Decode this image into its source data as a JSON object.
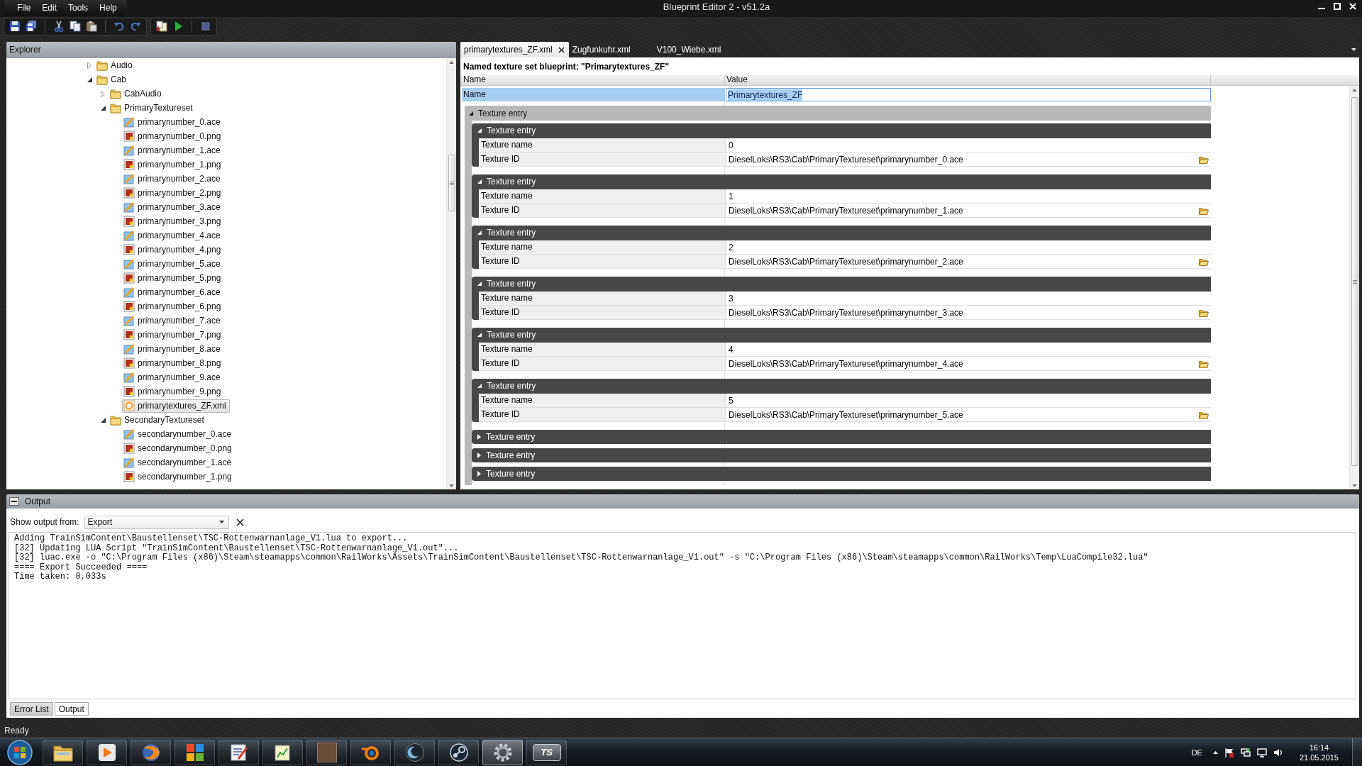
{
  "window": {
    "title": "Blueprint Editor 2 - v51.2a"
  },
  "menu": [
    "File",
    "Edit",
    "Tools",
    "Help"
  ],
  "explorer": {
    "title": "Explorer",
    "tree": [
      {
        "label": "Audio",
        "kind": "folder",
        "expanded": false,
        "selected": false
      },
      {
        "label": "Cab",
        "kind": "folder",
        "expanded": true,
        "selected": false,
        "children": [
          {
            "label": "CabAudio",
            "kind": "folder",
            "expanded": false,
            "selected": false
          },
          {
            "label": "PrimaryTextureset",
            "kind": "folder",
            "expanded": true,
            "selected": false,
            "children": [
              {
                "label": "primarynumber_0.ace",
                "kind": "texture",
                "selected": false
              },
              {
                "label": "primarynumber_0.png",
                "kind": "image",
                "selected": false
              },
              {
                "label": "primarynumber_1.ace",
                "kind": "texture",
                "selected": false
              },
              {
                "label": "primarynumber_1.png",
                "kind": "image",
                "selected": false
              },
              {
                "label": "primarynumber_2.ace",
                "kind": "texture",
                "selected": false
              },
              {
                "label": "primarynumber_2.png",
                "kind": "image",
                "selected": false
              },
              {
                "label": "primarynumber_3.ace",
                "kind": "texture",
                "selected": false
              },
              {
                "label": "primarynumber_3.png",
                "kind": "image",
                "selected": false
              },
              {
                "label": "primarynumber_4.ace",
                "kind": "texture",
                "selected": false
              },
              {
                "label": "primarynumber_4.png",
                "kind": "image",
                "selected": false
              },
              {
                "label": "primarynumber_5.ace",
                "kind": "texture",
                "selected": false
              },
              {
                "label": "primarynumber_5.png",
                "kind": "image",
                "selected": false
              },
              {
                "label": "primarynumber_6.ace",
                "kind": "texture",
                "selected": false
              },
              {
                "label": "primarynumber_6.png",
                "kind": "image",
                "selected": false
              },
              {
                "label": "primarynumber_7.ace",
                "kind": "texture",
                "selected": false
              },
              {
                "label": "primarynumber_7.png",
                "kind": "image",
                "selected": false
              },
              {
                "label": "primarynumber_8.ace",
                "kind": "texture",
                "selected": false
              },
              {
                "label": "primarynumber_8.png",
                "kind": "image",
                "selected": false
              },
              {
                "label": "primarynumber_9.ace",
                "kind": "texture",
                "selected": false
              },
              {
                "label": "primarynumber_9.png",
                "kind": "image",
                "selected": false
              },
              {
                "label": "primarytextures_ZF.xml",
                "kind": "blueprint",
                "selected": true
              }
            ]
          },
          {
            "label": "SecondaryTextureset",
            "kind": "folder",
            "expanded": true,
            "selected": false,
            "children": [
              {
                "label": "secondarynumber_0.ace",
                "kind": "texture",
                "selected": false
              },
              {
                "label": "secondarynumber_0.png",
                "kind": "image",
                "selected": false
              },
              {
                "label": "secondarynumber_1.ace",
                "kind": "texture",
                "selected": false
              },
              {
                "label": "secondarynumber_1.png",
                "kind": "image",
                "selected": false
              }
            ]
          }
        ]
      }
    ]
  },
  "editor": {
    "tabs": [
      {
        "label": "primarytextures_ZF.xml",
        "selected": true
      },
      {
        "label": "Zugfunkuhr.xml",
        "selected": false
      },
      {
        "label": "V100_Wiebe.xml",
        "selected": false
      }
    ],
    "heading": "Named texture set blueprint: \"Primarytextures_ZF\"",
    "columns": [
      "Name",
      "Value"
    ],
    "name_row": {
      "label": "Name",
      "value": "Primarytextures_ZF",
      "selected": true
    },
    "group": {
      "label": "Texture entry",
      "expanded": true,
      "entries": [
        {
          "label": "Texture entry",
          "expanded": true,
          "fields": [
            {
              "label": "Texture name",
              "value": "0",
              "browse": false
            },
            {
              "label": "Texture ID",
              "value": "DieselLoks\\RS3\\Cab\\PrimaryTextureset\\primarynumber_0.ace",
              "browse": true
            }
          ]
        },
        {
          "label": "Texture entry",
          "expanded": true,
          "fields": [
            {
              "label": "Texture name",
              "value": "1",
              "browse": false
            },
            {
              "label": "Texture ID",
              "value": "DieselLoks\\RS3\\Cab\\PrimaryTextureset\\primarynumber_1.ace",
              "browse": true
            }
          ]
        },
        {
          "label": "Texture entry",
          "expanded": true,
          "fields": [
            {
              "label": "Texture name",
              "value": "2",
              "browse": false
            },
            {
              "label": "Texture ID",
              "value": "DieselLoks\\RS3\\Cab\\PrimaryTextureset\\primarynumber_2.ace",
              "browse": true
            }
          ]
        },
        {
          "label": "Texture entry",
          "expanded": true,
          "fields": [
            {
              "label": "Texture name",
              "value": "3",
              "browse": false
            },
            {
              "label": "Texture ID",
              "value": "DieselLoks\\RS3\\Cab\\PrimaryTextureset\\primarynumber_3.ace",
              "browse": true
            }
          ]
        },
        {
          "label": "Texture entry",
          "expanded": true,
          "fields": [
            {
              "label": "Texture name",
              "value": "4",
              "browse": false
            },
            {
              "label": "Texture ID",
              "value": "DieselLoks\\RS3\\Cab\\PrimaryTextureset\\primarynumber_4.ace",
              "browse": true
            }
          ]
        },
        {
          "label": "Texture entry",
          "expanded": true,
          "fields": [
            {
              "label": "Texture name",
              "value": "5",
              "browse": false
            },
            {
              "label": "Texture ID",
              "value": "DieselLoks\\RS3\\Cab\\PrimaryTextureset\\primarynumber_5.ace",
              "browse": true
            }
          ]
        },
        {
          "label": "Texture entry",
          "expanded": false
        },
        {
          "label": "Texture entry",
          "expanded": false
        },
        {
          "label": "Texture entry",
          "expanded": false
        }
      ]
    }
  },
  "output": {
    "title": "Output",
    "source_label": "Show output from:",
    "source": "Export",
    "lines": [
      "Adding TrainSimContent\\Baustellenset\\TSC-Rottenwarnanlage_V1.lua to export...",
      "[32] Updating LUA Script \"TrainSimContent\\Baustellenset\\TSC-Rottenwarnanlage_V1.out\"...",
      "[32] luac.exe -o \"C:\\Program Files (x86)\\Steam\\steamapps\\common\\RailWorks\\Assets\\TrainSimContent\\Baustellenset\\TSC-Rottenwarnanlage_V1.out\" -s \"C:\\Program Files (x86)\\Steam\\steamapps\\common\\RailWorks\\Temp\\LuaCompile32.lua\"",
      "==== Export Succeeded ====",
      "Time taken: 0,033s"
    ],
    "tabs": [
      {
        "label": "Error List",
        "selected": false
      },
      {
        "label": "Output",
        "selected": true
      }
    ]
  },
  "status_bar": {
    "text": "Ready"
  },
  "taskbar": {
    "apps": [
      {
        "kind": "folder",
        "active": false
      },
      {
        "kind": "player",
        "active": false
      },
      {
        "kind": "globe",
        "active": false
      },
      {
        "kind": "tiles",
        "active": false
      },
      {
        "kind": "editor",
        "active": false
      },
      {
        "kind": "chart",
        "active": false
      },
      {
        "kind": "photo",
        "active": false
      },
      {
        "kind": "ring",
        "active": false
      },
      {
        "kind": "crescent",
        "active": false
      },
      {
        "kind": "linked",
        "active": false
      },
      {
        "kind": "gear",
        "active": true
      },
      {
        "kind": "badge",
        "label": "TS",
        "active": false
      }
    ],
    "tray": {
      "language": "DE",
      "time": "16:14",
      "date": "21.05.2015"
    }
  }
}
